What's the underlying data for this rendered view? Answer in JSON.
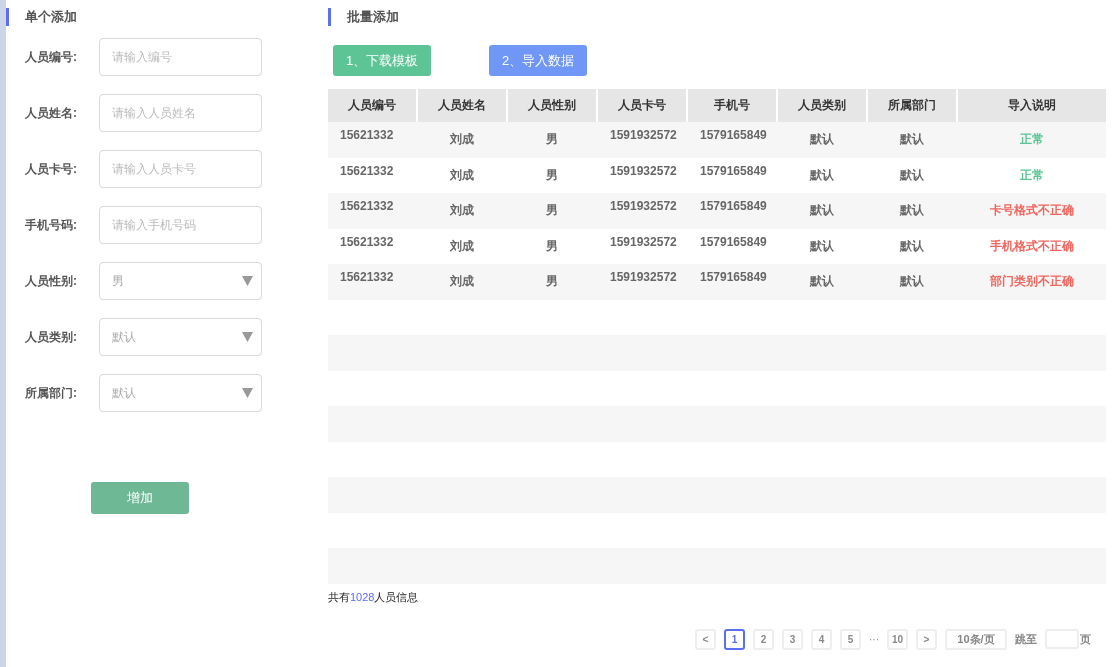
{
  "single_add": {
    "title": "单个添加",
    "fields": [
      {
        "kind": "input",
        "label": "人员编号:",
        "placeholder": "请输入编号"
      },
      {
        "kind": "input",
        "label": "人员姓名:",
        "placeholder": "请输入人员姓名"
      },
      {
        "kind": "input",
        "label": "人员卡号:",
        "placeholder": "请输入人员卡号"
      },
      {
        "kind": "input",
        "label": "手机号码:",
        "placeholder": "请输入手机号码"
      },
      {
        "kind": "select",
        "label": "人员性别:",
        "placeholder": "男"
      },
      {
        "kind": "select",
        "label": "人员类别:",
        "placeholder": "默认"
      },
      {
        "kind": "select",
        "label": "所属部门:",
        "placeholder": "默认"
      }
    ],
    "add_button": "增加"
  },
  "batch_add": {
    "title": "批量添加",
    "buttons": [
      {
        "label": "1、下载模板",
        "color": "#5cc495"
      },
      {
        "label": "2、导入数据",
        "color": "#7097f6"
      }
    ],
    "table": {
      "columns": [
        "人员编号",
        "人员姓名",
        "人员性别",
        "人员卡号",
        "手机号",
        "人员类别",
        "所属部门",
        "导入说明"
      ],
      "rows": [
        {
          "cells": [
            "15621332",
            "刘成",
            "男",
            "1591932572",
            "1579165849",
            "默认",
            "默认"
          ],
          "note": "正常",
          "ok": true
        },
        {
          "cells": [
            "15621332",
            "刘成",
            "男",
            "1591932572",
            "1579165849",
            "默认",
            "默认"
          ],
          "note": "正常",
          "ok": true
        },
        {
          "cells": [
            "15621332",
            "刘成",
            "男",
            "1591932572",
            "1579165849",
            "默认",
            "默认"
          ],
          "note": "卡号格式不正确",
          "ok": false
        },
        {
          "cells": [
            "15621332",
            "刘成",
            "男",
            "1591932572",
            "1579165849",
            "默认",
            "默认"
          ],
          "note": "手机格式不正确",
          "ok": false
        },
        {
          "cells": [
            "15621332",
            "刘成",
            "男",
            "1591932572",
            "1579165849",
            "默认",
            "默认"
          ],
          "note": "部门类别不正确",
          "ok": false
        }
      ]
    },
    "total": {
      "prefix": "共有",
      "count": "1028",
      "suffix": "人员信息"
    },
    "pagination": {
      "prev": "<",
      "pages": [
        {
          "label": "1",
          "selected": true
        },
        {
          "label": "2",
          "selected": false
        },
        {
          "label": "3",
          "selected": false
        },
        {
          "label": "4",
          "selected": false
        },
        {
          "label": "5",
          "selected": false
        }
      ],
      "ellipsis": "···",
      "last": "10",
      "next": ">",
      "page_size": "10条/页",
      "jump_label": "跳至",
      "page_unit": "页"
    }
  }
}
